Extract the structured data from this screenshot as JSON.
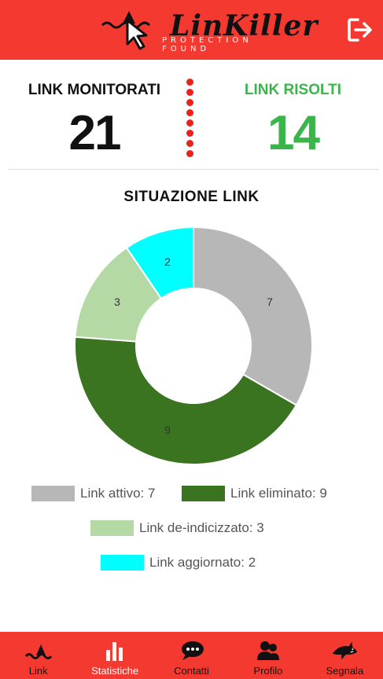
{
  "header": {
    "logo_title": "LinKiller",
    "logo_subtitle": "PROTECTION FOUND",
    "logout_icon": "logout-icon"
  },
  "stats": {
    "monitored_label": "LINK MONITORATI",
    "monitored_value": "21",
    "resolved_label": "LINK RISOLTI",
    "resolved_value": "14"
  },
  "chart_title": "SITUAZIONE LINK",
  "chart_data": {
    "type": "pie",
    "donut": true,
    "categories": [
      "Link attivo",
      "Link eliminato",
      "Link de-indicizzato",
      "Link aggiornato"
    ],
    "values": [
      7,
      9,
      3,
      2
    ],
    "colors": [
      "#b7b7b7",
      "#3a7421",
      "#b5d9a5",
      "#00ffff"
    ],
    "legend": [
      "Link attivo: 7",
      "Link eliminato: 9",
      "Link de-indicizzato: 3",
      "Link aggiornato: 2"
    ]
  },
  "nav": {
    "items": [
      {
        "label": "Link",
        "icon": "shark-fin-icon"
      },
      {
        "label": "Statistiche",
        "icon": "bar-chart-icon"
      },
      {
        "label": "Contatti",
        "icon": "chat-bubble-icon"
      },
      {
        "label": "Profilo",
        "icon": "users-icon"
      },
      {
        "label": "Segnala",
        "icon": "shark-icon"
      }
    ]
  },
  "colors": {
    "brand_red": "#f43a30",
    "resolved_green": "#39b54a",
    "dots_red": "#e8231a"
  }
}
